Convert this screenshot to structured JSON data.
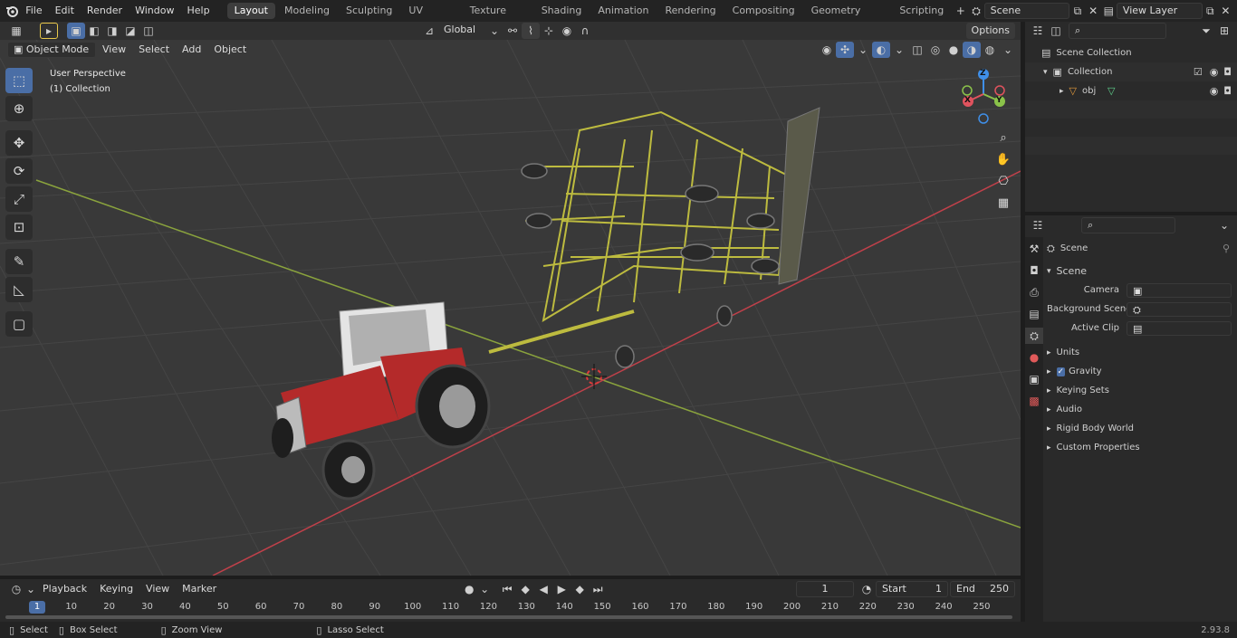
{
  "topbar": {
    "menus": [
      "File",
      "Edit",
      "Render",
      "Window",
      "Help"
    ],
    "workspaces": [
      "Layout",
      "Modeling",
      "Sculpting",
      "UV Editing",
      "Texture Paint",
      "Shading",
      "Animation",
      "Rendering",
      "Compositing",
      "Geometry Nodes",
      "Scripting"
    ],
    "active_workspace": "Layout",
    "scene_name": "Scene",
    "view_layer": "View Layer"
  },
  "tool_header": {
    "transform_orientation": "Global",
    "options_label": "Options"
  },
  "viewport_header": {
    "mode": "Object Mode",
    "menus": [
      "View",
      "Select",
      "Add",
      "Object"
    ]
  },
  "viewport": {
    "perspective_label": "User Perspective",
    "collection_label": "(1) Collection",
    "gizmo_axes": [
      "X",
      "Y",
      "Z"
    ]
  },
  "outliner": {
    "search_placeholder": "",
    "items": [
      {
        "label": "Scene Collection",
        "level": 0
      },
      {
        "label": "Collection",
        "level": 1
      },
      {
        "label": "obj",
        "level": 2
      }
    ]
  },
  "properties": {
    "breadcrumb": "Scene",
    "panel_title": "Scene",
    "fields": [
      {
        "label": "Camera"
      },
      {
        "label": "Background Scene"
      },
      {
        "label": "Active Clip"
      }
    ],
    "sections": [
      "Units",
      "Gravity",
      "Keying Sets",
      "Audio",
      "Rigid Body World",
      "Custom Properties"
    ],
    "gravity_checked": true
  },
  "timeline": {
    "menus": [
      "Playback",
      "Keying",
      "View",
      "Marker"
    ],
    "current_frame": "1",
    "start_label": "Start",
    "start_value": "1",
    "end_label": "End",
    "end_value": "250",
    "ticks": [
      "1",
      "10",
      "20",
      "30",
      "40",
      "50",
      "60",
      "70",
      "80",
      "90",
      "100",
      "110",
      "120",
      "130",
      "140",
      "150",
      "160",
      "170",
      "180",
      "190",
      "200",
      "210",
      "220",
      "230",
      "240",
      "250"
    ]
  },
  "statusbar": {
    "select": "Select",
    "box_select": "Box Select",
    "zoom_view": "Zoom View",
    "lasso_select": "Lasso Select",
    "version": "2.93.8"
  },
  "colors": {
    "accent": "#4a6ea6",
    "x_axis": "#e0535e",
    "y_axis": "#8bc34a",
    "z_axis": "#3f8fe8",
    "tractor_red": "#b42a2a",
    "implement_yellow": "#bdbb3f"
  }
}
